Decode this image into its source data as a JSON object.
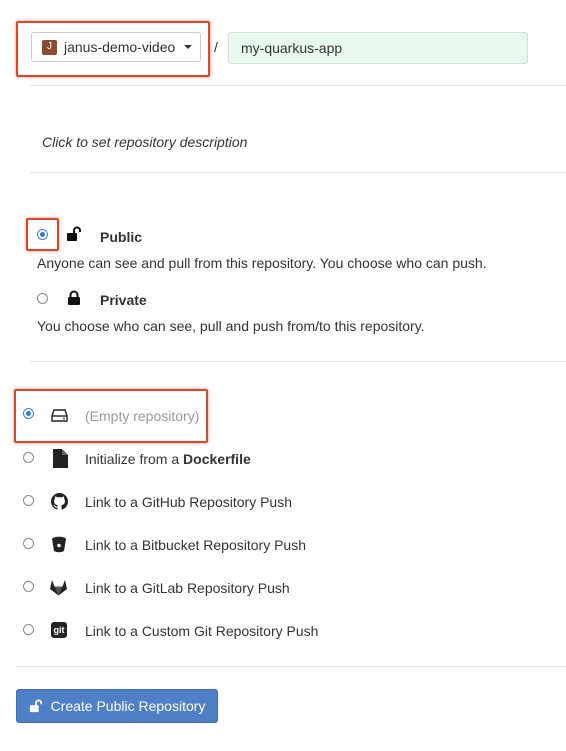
{
  "namespace": {
    "avatar_letter": "J",
    "avatar_color": "#8b4a32",
    "name": "janus-demo-video",
    "separator": "/"
  },
  "repo_name": {
    "value": "my-quarkus-app"
  },
  "description": {
    "placeholder": "Click to set repository description"
  },
  "visibility": {
    "public": {
      "label": "Public",
      "desc": "Anyone can see and pull from this repository. You choose who can push.",
      "selected": true
    },
    "private": {
      "label": "Private",
      "desc": "You choose who can see, pull and push from/to this repository.",
      "selected": false
    }
  },
  "init_options": [
    {
      "icon": "drive-icon",
      "label": "(Empty repository)",
      "selected": true
    },
    {
      "icon": "file-icon",
      "label_prefix": "Initialize from a ",
      "label_bold": "Dockerfile",
      "selected": false
    },
    {
      "icon": "github-icon",
      "label": "Link to a GitHub Repository Push",
      "selected": false
    },
    {
      "icon": "bitbucket-icon",
      "label": "Link to a Bitbucket Repository Push",
      "selected": false
    },
    {
      "icon": "gitlab-icon",
      "label": "Link to a GitLab Repository Push",
      "selected": false
    },
    {
      "icon": "git-icon",
      "label": "Link to a Custom Git Repository Push",
      "selected": false
    }
  ],
  "create_button": {
    "label": "Create Public Repository",
    "color": "#4f7fc4"
  },
  "highlight_color": "#d9472b"
}
